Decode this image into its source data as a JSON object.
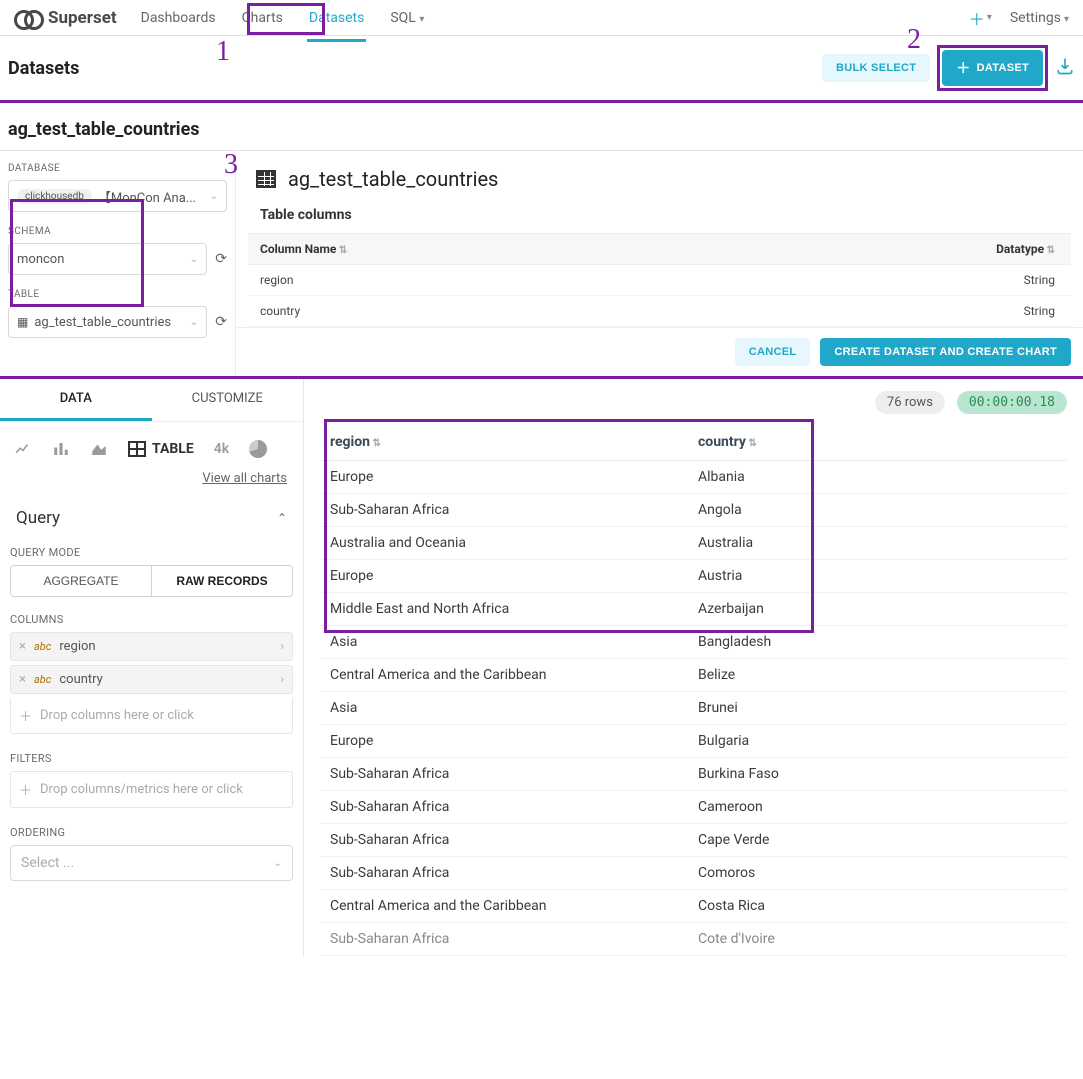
{
  "brand": "Superset",
  "nav": {
    "dashboards": "Dashboards",
    "charts": "Charts",
    "datasets": "Datasets",
    "sql": "SQL",
    "settings": "Settings"
  },
  "datasets_bar": {
    "title": "Datasets",
    "bulk_select": "BULK SELECT",
    "add_dataset": "DATASET"
  },
  "dataset_name": "ag_test_table_countries",
  "left_panel": {
    "database_label": "DATABASE",
    "database_tag": "clickhousedb",
    "database_value": "【MonCon Ana...",
    "schema_label": "SCHEMA",
    "schema_value": "moncon",
    "table_label": "TABLE",
    "table_value": "ag_test_table_countries"
  },
  "right_panel": {
    "title": "ag_test_table_countries",
    "table_columns_label": "Table columns",
    "col_name_header": "Column Name",
    "datatype_header": "Datatype",
    "rows": [
      {
        "name": "region",
        "type": "String"
      },
      {
        "name": "country",
        "type": "String"
      }
    ],
    "cancel": "CANCEL",
    "create_chart": "CREATE DATASET AND CREATE CHART"
  },
  "bottom": {
    "tab_data": "DATA",
    "tab_customize": "CUSTOMIZE",
    "viz_table": "TABLE",
    "viz_4k": "4k",
    "view_all": "View all charts",
    "query_title": "Query",
    "query_mode_label": "QUERY MODE",
    "seg_aggregate": "AGGREGATE",
    "seg_raw": "RAW RECORDS",
    "columns_label": "COLUMNS",
    "abc": "abc",
    "columns": [
      "region",
      "country"
    ],
    "drop_columns_hint": "Drop columns here or click",
    "filters_label": "FILTERS",
    "drop_filters_hint": "Drop columns/metrics here or click",
    "ordering_label": "ORDERING",
    "ordering_placeholder": "Select ..."
  },
  "results": {
    "rowcount": "76 rows",
    "elapsed": "00:00:00.18",
    "headers": {
      "region": "region",
      "country": "country"
    },
    "rows": [
      {
        "region": "Europe",
        "country": "Albania"
      },
      {
        "region": "Sub-Saharan Africa",
        "country": "Angola"
      },
      {
        "region": "Australia and Oceania",
        "country": "Australia"
      },
      {
        "region": "Europe",
        "country": "Austria"
      },
      {
        "region": "Middle East and North Africa",
        "country": "Azerbaijan"
      },
      {
        "region": "Asia",
        "country": "Bangladesh"
      },
      {
        "region": "Central America and the Caribbean",
        "country": "Belize"
      },
      {
        "region": "Asia",
        "country": "Brunei"
      },
      {
        "region": "Europe",
        "country": "Bulgaria"
      },
      {
        "region": "Sub-Saharan Africa",
        "country": "Burkina Faso"
      },
      {
        "region": "Sub-Saharan Africa",
        "country": "Cameroon"
      },
      {
        "region": "Sub-Saharan Africa",
        "country": "Cape Verde"
      },
      {
        "region": "Sub-Saharan Africa",
        "country": "Comoros"
      },
      {
        "region": "Central America and the Caribbean",
        "country": "Costa Rica"
      },
      {
        "region": "Sub-Saharan Africa",
        "country": "Cote d'Ivoire"
      }
    ]
  },
  "annotations": {
    "n1": "1",
    "n2": "2",
    "n3": "3"
  }
}
